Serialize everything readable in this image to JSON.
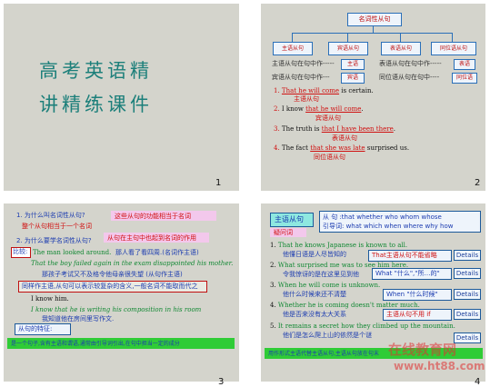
{
  "slide1": {
    "title_line1": "高考英语精",
    "title_line2": "讲精练课件",
    "page": "1"
  },
  "slide2": {
    "page": "2",
    "top_node": "名词性从句",
    "nodes": [
      "主语从句",
      "宾语从句",
      "表语从句",
      "同位语从句"
    ],
    "notes": [
      "主语从句在句中作-----",
      "宾语从句在句中作---",
      "表语从句在句中作-----",
      "同位语从句在句中----"
    ],
    "note_boxes": [
      "主语",
      "宾语",
      "表语",
      "同位语"
    ],
    "examples": [
      {
        "num": "1.",
        "pre": "",
        "hl": "That he will come",
        "post": " is certain.",
        "tag": "主语从句"
      },
      {
        "num": "2.",
        "pre": "I know ",
        "hl": "that he will come",
        "post": ".",
        "tag": "宾语从句"
      },
      {
        "num": "3.",
        "pre": "The truth is ",
        "hl": "that I have been there",
        "post": ".",
        "tag": "表语从句"
      },
      {
        "num": "4.",
        "pre": "The fact ",
        "hl": "that she was late",
        "post": " surprised us.",
        "tag": "同位语从句"
      }
    ]
  },
  "slide3": {
    "page": "3",
    "q1": "1. 为什么叫名词性从句?",
    "q1_note": "这些从句的功能相当于名词",
    "q1_sub": "整个从句相当于一个名词",
    "q2": "2. 为什么要学名词性从句?",
    "q2_note": "从句在主句中也起到名词的作用",
    "tag_compare": "比较:",
    "line_a": "The man looked around.",
    "line_a_cn": "那人看了看四周.(名词作主语)",
    "line_b": "That the boy failed again in the exam disappointed his mother.",
    "line_b_cn": "那孩子考试又不及格令他母亲很失望    (从句作主语)",
    "boxed": "同样作主语,从句可以表示较复杂的含义,一般名词不能取而代之",
    "line_c": "I know him.",
    "line_d": "I know that he is writing his composition in his room",
    "line_d_cn": "我知道他在房间里写作文.",
    "summary_q": "从句的特征:",
    "bottom_bar": "是一个句子,含有主语和谓语,通常由引导词引出,在句中担当一定的成分"
  },
  "slide4": {
    "page": "4",
    "heading": "主语从句",
    "heading_sub": "疑问词",
    "intro_line1": "从 句 :that  whether  who  whom  whose",
    "intro_line2": "引导词: what  which  when  where  why  how",
    "items": [
      {
        "num": "1.",
        "en": "That he knows Japanese is known to all.",
        "cn": "他懂日语是人尽皆知的",
        "note": "That主语从句不能省略",
        "btn": "Details"
      },
      {
        "num": "2.",
        "en": "What surprised me was to see him here.",
        "cn": "令我惊讶的是在这里见到他",
        "note": "What \"什么\",\"所…的\"",
        "btn": "Details"
      },
      {
        "num": "3.",
        "en": "When he will come is unknown.",
        "cn": "他什么时候来还不清楚",
        "note": "When \"什么时候\"",
        "btn": "Details"
      },
      {
        "num": "4.",
        "en": "Whether he is coming doesn't matter much.",
        "cn": "他是否来没有太大关系",
        "note": "主语从句不用 if",
        "btn": "Details"
      },
      {
        "num": "5.",
        "en": "It remains a secret how they climbed up the mountain.",
        "cn": "他们是怎么爬上山的依然是个谜",
        "note": "",
        "btn": "Details"
      }
    ],
    "bottom_bar": "用作形式主语代替主语从句,主语从句放在句末",
    "watermark_cn": "在线教育网",
    "watermark_url": "www.ht88.com"
  }
}
